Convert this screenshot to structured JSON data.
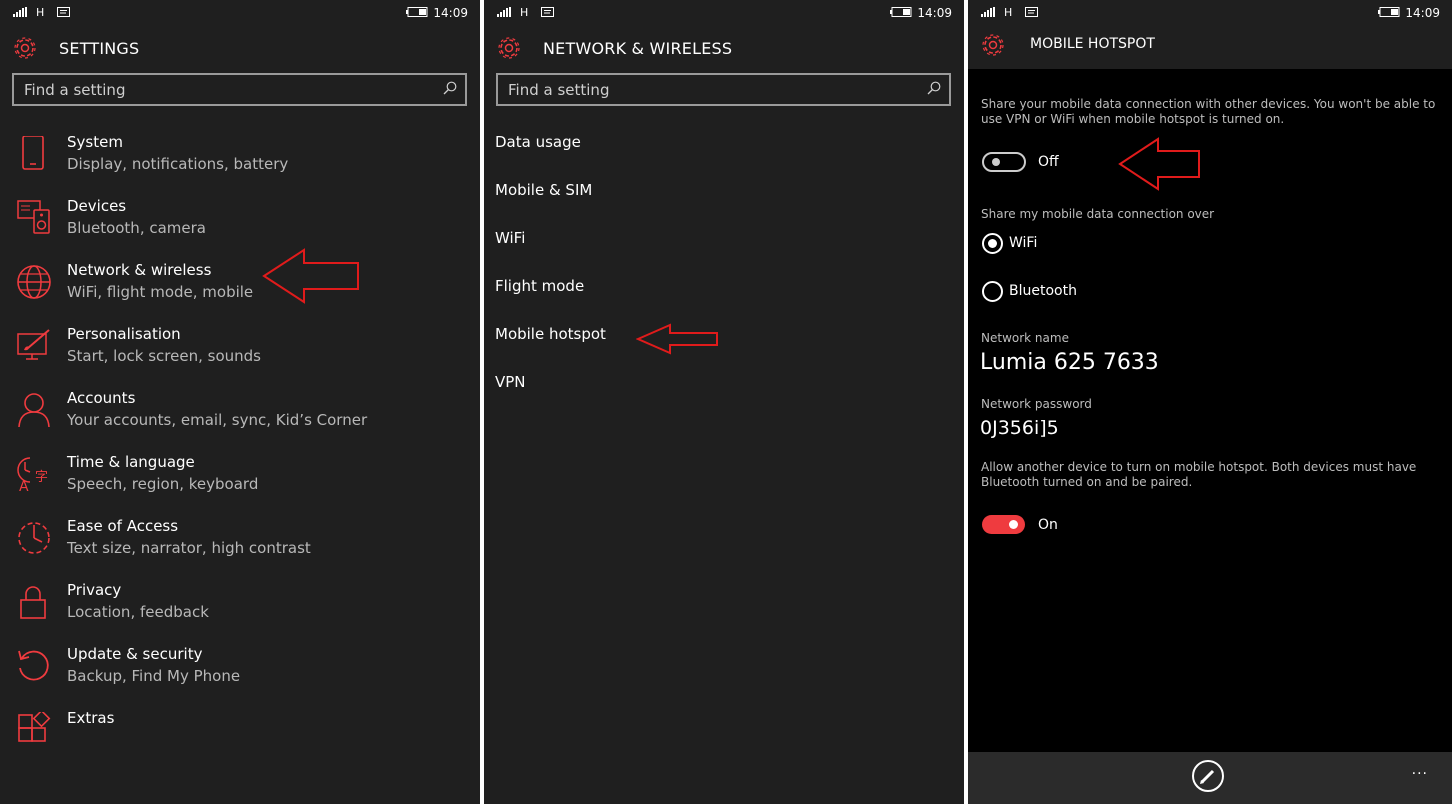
{
  "status": {
    "network_type": "H",
    "time": "14:09"
  },
  "accent_color": "#ef3b3f",
  "arrow_color": "#e01b1b",
  "settings": {
    "title": "SETTINGS",
    "search_placeholder": "Find a setting",
    "items": [
      {
        "title": "System",
        "subtitle": "Display, notifications, battery",
        "icon": "phone-icon"
      },
      {
        "title": "Devices",
        "subtitle": "Bluetooth, camera",
        "icon": "devices-icon"
      },
      {
        "title": "Network & wireless",
        "subtitle": "WiFi, flight mode, mobile",
        "icon": "globe-icon"
      },
      {
        "title": "Personalisation",
        "subtitle": "Start, lock screen, sounds",
        "icon": "paint-icon"
      },
      {
        "title": "Accounts",
        "subtitle": "Your accounts, email, sync, Kid’s Corner",
        "icon": "person-icon"
      },
      {
        "title": "Time & language",
        "subtitle": "Speech, region, keyboard",
        "icon": "time-language-icon"
      },
      {
        "title": "Ease of Access",
        "subtitle": "Text size, narrator, high contrast",
        "icon": "ease-of-access-icon"
      },
      {
        "title": "Privacy",
        "subtitle": "Location, feedback",
        "icon": "lock-icon"
      },
      {
        "title": "Update & security",
        "subtitle": "Backup, Find My Phone",
        "icon": "refresh-icon"
      },
      {
        "title": "Extras",
        "subtitle": "",
        "icon": "extras-icon"
      }
    ]
  },
  "network": {
    "title": "NETWORK & WIRELESS",
    "search_placeholder": "Find a setting",
    "items": [
      "Data usage",
      "Mobile & SIM",
      "WiFi",
      "Flight mode",
      "Mobile hotspot",
      "VPN"
    ]
  },
  "hotspot": {
    "title": "MOBILE HOTSPOT",
    "description": "Share your mobile data connection with other devices. You won't be able to use VPN or WiFi when mobile hotspot is turned on.",
    "toggle_state": "Off",
    "share_over_label": "Share my mobile data connection over",
    "share_options": [
      "WiFi",
      "Bluetooth"
    ],
    "selected_option": "WiFi",
    "network_name_label": "Network name",
    "network_name": "Lumia 625 7633",
    "password_label": "Network password",
    "password": "0J356i]5",
    "bt_description": "Allow another device to turn on mobile hotspot. Both devices must have Bluetooth turned on and be paired.",
    "bt_toggle_state": "On",
    "more_label": "..."
  }
}
